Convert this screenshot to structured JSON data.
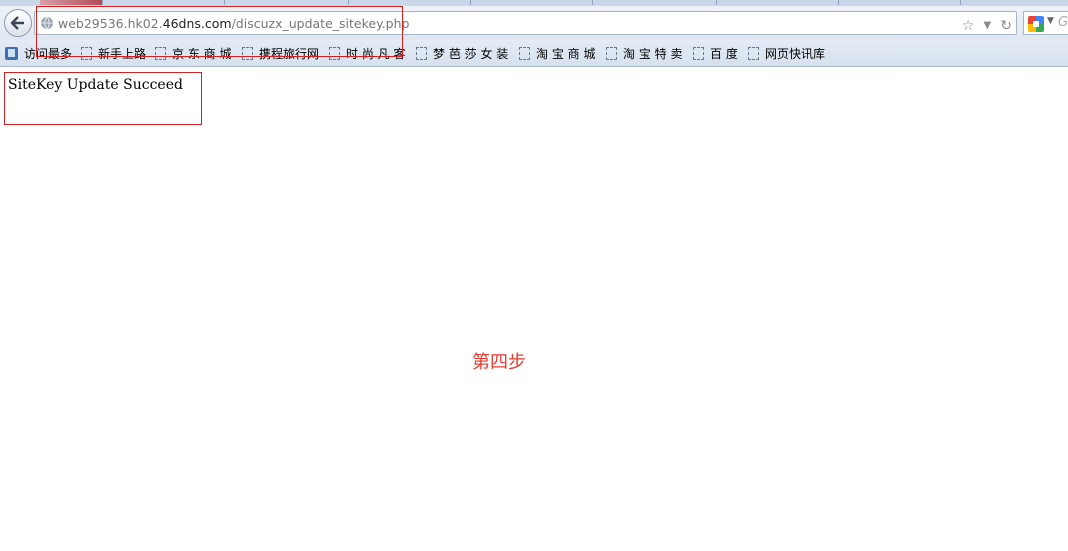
{
  "browser": {
    "address_bar": {
      "url_prefix": "web29536.hk02.",
      "url_domain": "46dns.com",
      "url_path": "/discuzx_update_sitekey.php"
    },
    "bookmarks": [
      {
        "label": "访问最多",
        "icon": "most-visited-icon"
      },
      {
        "label": "新手上路",
        "icon": "page-icon"
      },
      {
        "label": "京 东 商 城",
        "icon": "page-icon"
      },
      {
        "label": "携程旅行网",
        "icon": "page-icon"
      },
      {
        "label": "时 尚 凡 客",
        "icon": "page-icon"
      },
      {
        "label": "梦 芭 莎 女 装",
        "icon": "page-icon"
      },
      {
        "label": "淘 宝 商 城",
        "icon": "page-icon"
      },
      {
        "label": "淘 宝 特 卖",
        "icon": "page-icon"
      },
      {
        "label": "百 度",
        "icon": "page-icon"
      },
      {
        "label": "网页快讯库",
        "icon": "page-icon"
      }
    ],
    "search_hint": "G"
  },
  "page": {
    "message": "SiteKey Update Succeed",
    "step_caption": "第四步"
  },
  "colors": {
    "annotation_red": "#d42020",
    "caption_red": "#e53a2f"
  }
}
